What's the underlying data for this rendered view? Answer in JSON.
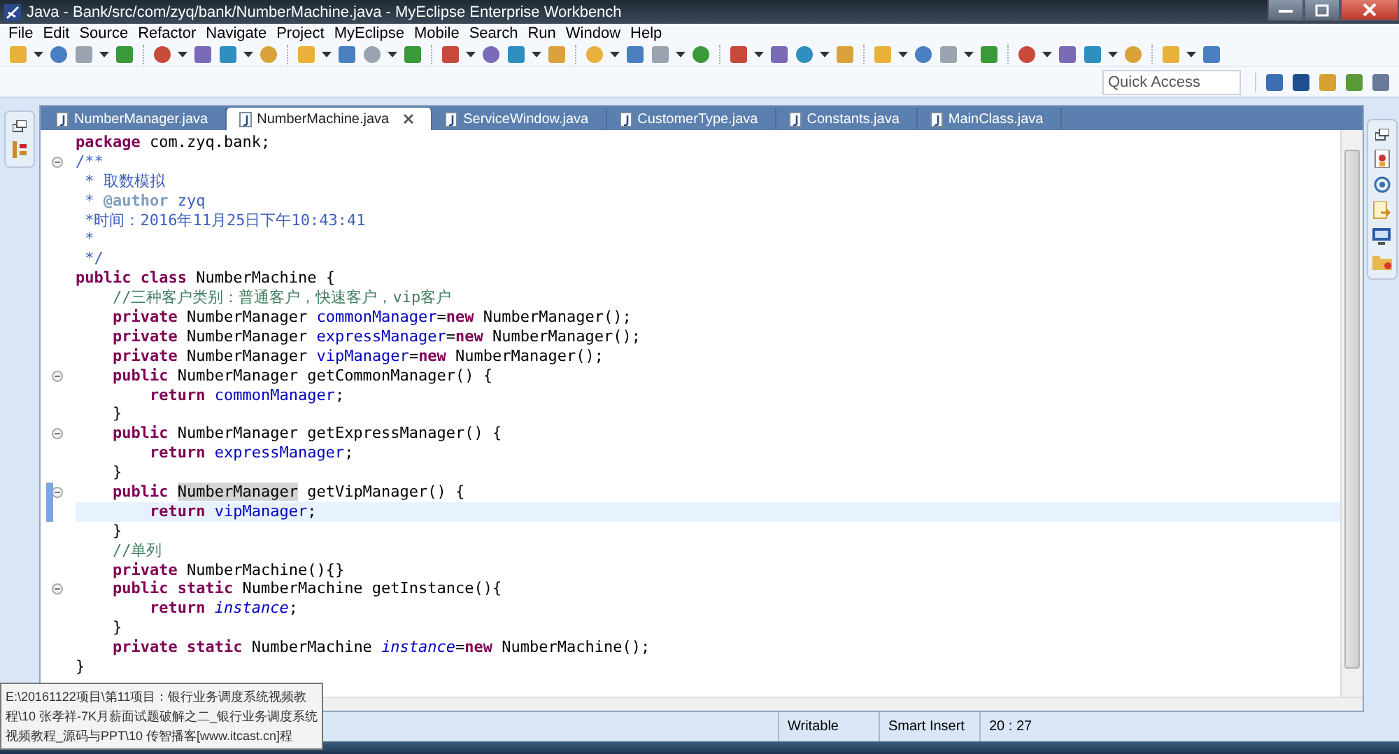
{
  "window": {
    "title": "Java - Bank/src/com/zyq/bank/NumberMachine.java - MyEclipse Enterprise Workbench"
  },
  "menu": [
    "File",
    "Edit",
    "Source",
    "Refactor",
    "Navigate",
    "Project",
    "MyEclipse",
    "Mobile",
    "Search",
    "Run",
    "Window",
    "Help"
  ],
  "quick_access": {
    "placeholder": "Quick Access"
  },
  "tabs": [
    {
      "label": "NumberManager.java",
      "selected": false
    },
    {
      "label": "NumberMachine.java",
      "selected": true
    },
    {
      "label": "ServiceWindow.java",
      "selected": false
    },
    {
      "label": "CustomerType.java",
      "selected": false
    },
    {
      "label": "Constants.java",
      "selected": false
    },
    {
      "label": "MainClass.java",
      "selected": false
    }
  ],
  "editor": {
    "lines": [
      {
        "fold": false,
        "current": false,
        "tokens": [
          {
            "kind": "kw",
            "t": "package"
          },
          {
            "kind": "plain",
            "t": " com.zyq.bank;"
          }
        ]
      },
      {
        "fold": true,
        "current": false,
        "tokens": [
          {
            "kind": "doc",
            "t": "/**"
          }
        ]
      },
      {
        "fold": false,
        "current": false,
        "tokens": [
          {
            "kind": "doc",
            "t": " * 取数模拟"
          }
        ]
      },
      {
        "fold": false,
        "current": false,
        "tokens": [
          {
            "kind": "doc",
            "t": " * "
          },
          {
            "kind": "doctag",
            "t": "@author"
          },
          {
            "kind": "doc",
            "t": " zyq"
          }
        ]
      },
      {
        "fold": false,
        "current": false,
        "tokens": [
          {
            "kind": "doc",
            "t": " *时间：2016年11月25日下午10:43:41"
          }
        ]
      },
      {
        "fold": false,
        "current": false,
        "tokens": [
          {
            "kind": "doc",
            "t": " *"
          }
        ]
      },
      {
        "fold": false,
        "current": false,
        "tokens": [
          {
            "kind": "doc",
            "t": " */"
          }
        ]
      },
      {
        "fold": false,
        "current": false,
        "tokens": [
          {
            "kind": "kw",
            "t": "public class"
          },
          {
            "kind": "plain",
            "t": " NumberMachine {"
          }
        ]
      },
      {
        "fold": false,
        "current": false,
        "tokens": [
          {
            "kind": "comment",
            "t": "    //三种客户类别：普通客户，快速客户，vip客户"
          }
        ]
      },
      {
        "fold": false,
        "current": false,
        "tokens": [
          {
            "kind": "kw",
            "t": "    private"
          },
          {
            "kind": "plain",
            "t": " NumberManager "
          },
          {
            "kind": "field",
            "t": "commonManager"
          },
          {
            "kind": "plain",
            "t": "="
          },
          {
            "kind": "kw",
            "t": "new"
          },
          {
            "kind": "plain",
            "t": " NumberManager();"
          }
        ]
      },
      {
        "fold": false,
        "current": false,
        "tokens": [
          {
            "kind": "kw",
            "t": "    private"
          },
          {
            "kind": "plain",
            "t": " NumberManager "
          },
          {
            "kind": "field",
            "t": "expressManager"
          },
          {
            "kind": "plain",
            "t": "="
          },
          {
            "kind": "kw",
            "t": "new"
          },
          {
            "kind": "plain",
            "t": " NumberManager();"
          }
        ]
      },
      {
        "fold": false,
        "current": false,
        "tokens": [
          {
            "kind": "kw",
            "t": "    private"
          },
          {
            "kind": "plain",
            "t": " NumberManager "
          },
          {
            "kind": "field",
            "t": "vipManager"
          },
          {
            "kind": "plain",
            "t": "="
          },
          {
            "kind": "kw",
            "t": "new"
          },
          {
            "kind": "plain",
            "t": " NumberManager();"
          }
        ]
      },
      {
        "fold": true,
        "current": false,
        "tokens": [
          {
            "kind": "kw",
            "t": "    public"
          },
          {
            "kind": "plain",
            "t": " NumberManager getCommonManager() {"
          }
        ]
      },
      {
        "fold": false,
        "current": false,
        "tokens": [
          {
            "kind": "kw",
            "t": "        return"
          },
          {
            "kind": "field",
            "t": " commonManager"
          },
          {
            "kind": "plain",
            "t": ";"
          }
        ]
      },
      {
        "fold": false,
        "current": false,
        "tokens": [
          {
            "kind": "plain",
            "t": "    }"
          }
        ]
      },
      {
        "fold": true,
        "current": false,
        "tokens": [
          {
            "kind": "kw",
            "t": "    public"
          },
          {
            "kind": "plain",
            "t": " NumberManager getExpressManager() {"
          }
        ]
      },
      {
        "fold": false,
        "current": false,
        "tokens": [
          {
            "kind": "kw",
            "t": "        return"
          },
          {
            "kind": "field",
            "t": " expressManager"
          },
          {
            "kind": "plain",
            "t": ";"
          }
        ]
      },
      {
        "fold": false,
        "current": false,
        "tokens": [
          {
            "kind": "plain",
            "t": "    }"
          }
        ]
      },
      {
        "fold": true,
        "current": false,
        "tokens": [
          {
            "kind": "kw",
            "t": "    public "
          },
          {
            "kind": "occurrence",
            "t": "NumberManager"
          },
          {
            "kind": "plain",
            "t": " getVipManager() {"
          }
        ]
      },
      {
        "fold": false,
        "current": true,
        "tokens": [
          {
            "kind": "kw",
            "t": "        return"
          },
          {
            "kind": "field",
            "t": " vipManager"
          },
          {
            "kind": "plain",
            "t": ";"
          }
        ]
      },
      {
        "fold": false,
        "current": false,
        "tokens": [
          {
            "kind": "plain",
            "t": "    }"
          }
        ]
      },
      {
        "fold": false,
        "current": false,
        "tokens": [
          {
            "kind": "comment",
            "t": "    //单列"
          }
        ]
      },
      {
        "fold": false,
        "current": false,
        "tokens": [
          {
            "kind": "kw",
            "t": "    private"
          },
          {
            "kind": "plain",
            "t": " NumberMachine(){}"
          }
        ]
      },
      {
        "fold": true,
        "current": false,
        "tokens": [
          {
            "kind": "kw",
            "t": "    public static"
          },
          {
            "kind": "plain",
            "t": " NumberMachine getInstance(){"
          }
        ]
      },
      {
        "fold": false,
        "current": false,
        "tokens": [
          {
            "kind": "kw",
            "t": "        return"
          },
          {
            "kind": "static",
            "t": " instance"
          },
          {
            "kind": "plain",
            "t": ";"
          }
        ]
      },
      {
        "fold": false,
        "current": false,
        "tokens": [
          {
            "kind": "plain",
            "t": "    }"
          }
        ]
      },
      {
        "fold": false,
        "current": false,
        "tokens": [
          {
            "kind": "kw",
            "t": "    private static"
          },
          {
            "kind": "plain",
            "t": " NumberMachine "
          },
          {
            "kind": "static",
            "t": "instance"
          },
          {
            "kind": "plain",
            "t": "="
          },
          {
            "kind": "kw",
            "t": "new"
          },
          {
            "kind": "plain",
            "t": " NumberMachine();"
          }
        ]
      },
      {
        "fold": false,
        "current": false,
        "tokens": [
          {
            "kind": "plain",
            "t": "}"
          }
        ]
      }
    ]
  },
  "tooltip": {
    "lines": [
      "E:\\20161122项目\\第11项目：银行业务调度系统视频教",
      "程\\10 张孝祥-7K月薪面试题破解之二_银行业务调度系统",
      "视频教程_源码与PPT\\10 传智播客[www.itcast.cn]程"
    ]
  },
  "status_bar": {
    "items": [
      "Writable",
      "Smart Insert",
      "20 : 27"
    ]
  }
}
